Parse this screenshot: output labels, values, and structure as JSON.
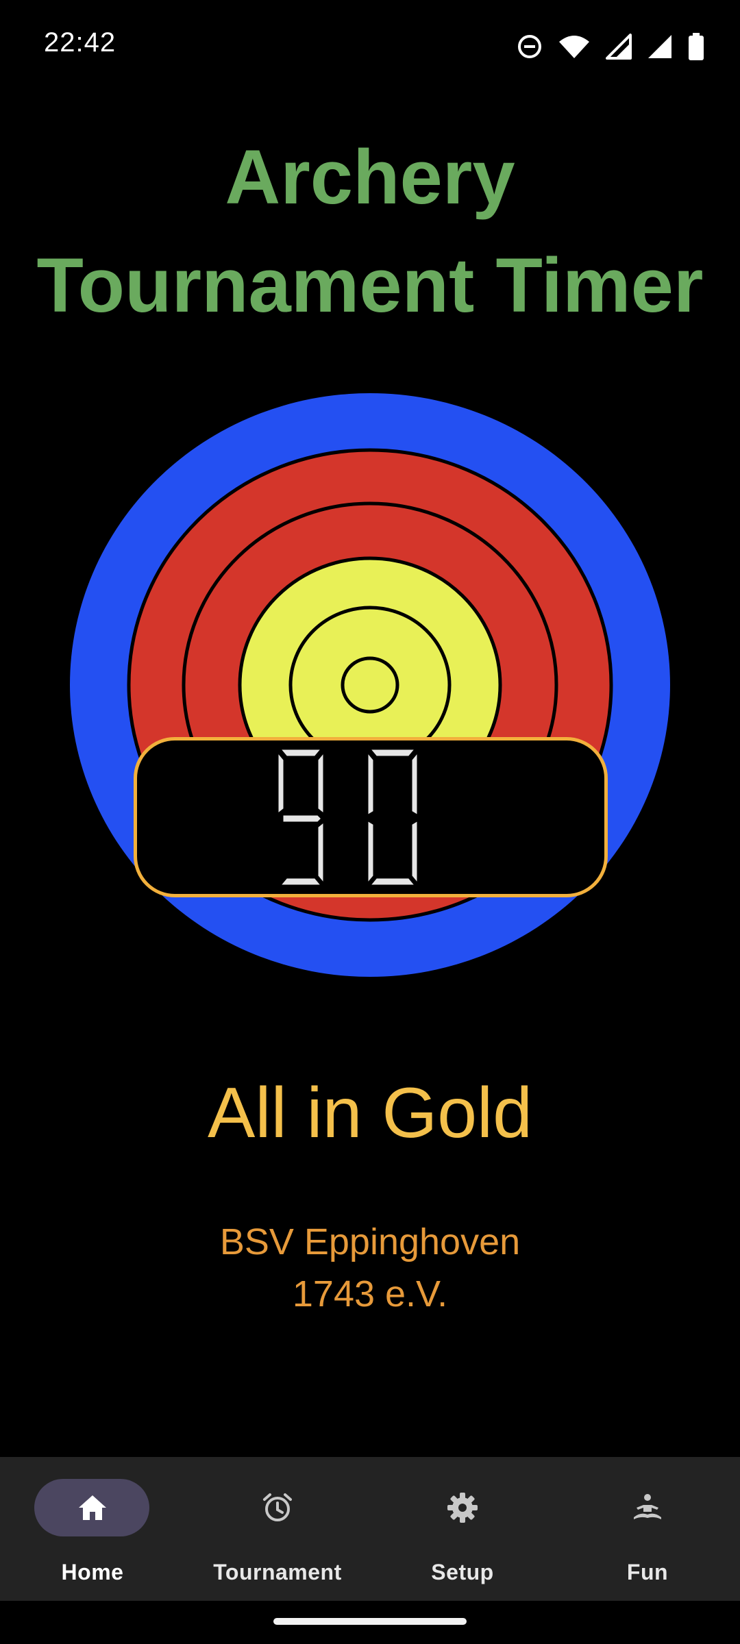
{
  "status_bar": {
    "time": "22:42",
    "icons": [
      "do-not-disturb-icon",
      "wifi-icon",
      "signal-icon",
      "signal-icon",
      "battery-icon"
    ]
  },
  "title": {
    "line1": "Archery",
    "line2": "Tournament Timer"
  },
  "timer": {
    "value": "90"
  },
  "message": "All in Gold",
  "club": {
    "line1": "BSV Eppinghoven",
    "line2": "1743 e.V."
  },
  "nav": {
    "items": [
      {
        "label": "Home",
        "icon": "home-icon",
        "selected": true
      },
      {
        "label": "Tournament",
        "icon": "alarm-clock-icon",
        "selected": false
      },
      {
        "label": "Setup",
        "icon": "gear-icon",
        "selected": false
      },
      {
        "label": "Fun",
        "icon": "meditation-icon",
        "selected": false
      }
    ]
  },
  "colors": {
    "title": "#6aaa5e",
    "message": "#f4c04b",
    "club": "#e79a3a",
    "target_blue": "#2450f2",
    "target_red": "#d4362b",
    "target_gold": "#e8f057",
    "timer_border": "#f2b03c",
    "nav_background": "#232323",
    "nav_selected_pill": "#4b4660"
  }
}
